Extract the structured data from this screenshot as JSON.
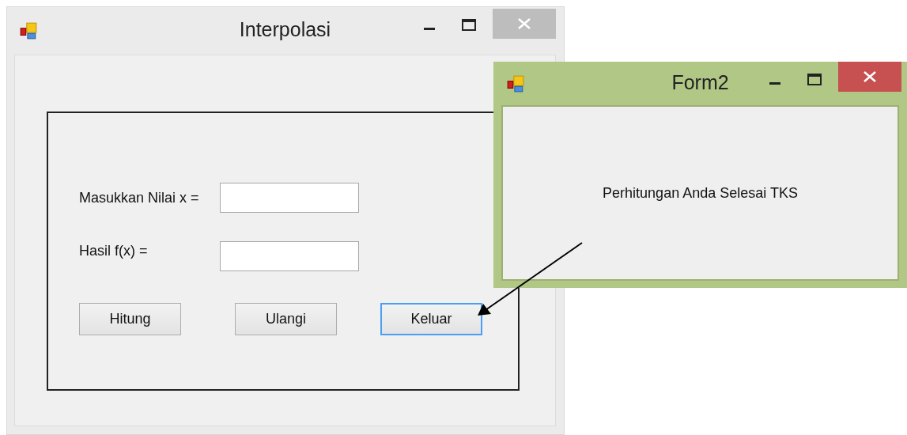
{
  "main_window": {
    "title": "Interpolasi",
    "active": false,
    "fields": [
      {
        "label": "Masukkan Nilai x ="
      },
      {
        "label": "Hasil f(x) ="
      }
    ],
    "buttons": [
      {
        "label": "Hitung",
        "focused": false
      },
      {
        "label": "Ulangi",
        "focused": false
      },
      {
        "label": "Keluar",
        "focused": true
      }
    ]
  },
  "dialog_window": {
    "title": "Form2",
    "active": true,
    "message": "Perhitungan Anda Selesai TKS"
  }
}
